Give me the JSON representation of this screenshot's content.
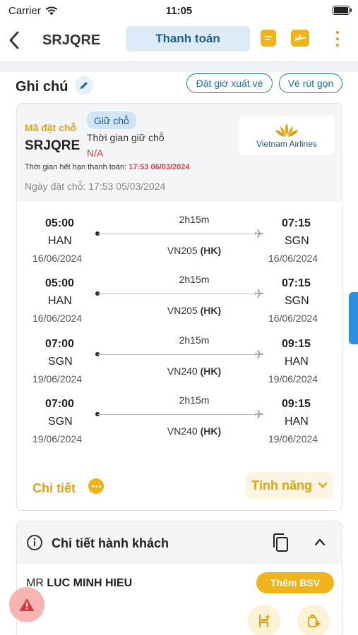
{
  "status_bar": {
    "carrier": "Carrier",
    "time": "11:05"
  },
  "header": {
    "title": "SRJQRE",
    "pay_tab": "Thanh toán"
  },
  "notes": {
    "label": "Ghi chú",
    "ticket_time_button": "Đặt giờ xuất vé",
    "short_ticket_button": "Vé rút gọn"
  },
  "booking": {
    "pnr_label": "Mã đặt chỗ",
    "pnr": "SRJQRE",
    "hold_badge": "Giữ chỗ",
    "hold_time_label": "Thời gian giữ chỗ",
    "hold_time_value": "N/A",
    "expire_label": "Thời gian hết hạn thanh toán:",
    "expire_value": "17:53 06/03/2024",
    "booking_date": "Ngày đặt chỗ: 17:53 05/03/2024",
    "airline": "Vietnam Airlines"
  },
  "flights": [
    {
      "dep_time": "05:00",
      "dep_code": "HAN",
      "dep_date": "16/06/2024",
      "duration": "2h15m",
      "flight_no": "VN205",
      "class": "(HK)",
      "arr_time": "07:15",
      "arr_code": "SGN",
      "arr_date": "16/06/2024"
    },
    {
      "dep_time": "05:00",
      "dep_code": "HAN",
      "dep_date": "16/06/2024",
      "duration": "2h15m",
      "flight_no": "VN205",
      "class": "(HK)",
      "arr_time": "07:15",
      "arr_code": "SGN",
      "arr_date": "16/06/2024"
    },
    {
      "dep_time": "07:00",
      "dep_code": "SGN",
      "dep_date": "19/06/2024",
      "duration": "2h15m",
      "flight_no": "VN240",
      "class": "(HK)",
      "arr_time": "09:15",
      "arr_code": "HAN",
      "arr_date": "19/06/2024"
    },
    {
      "dep_time": "07:00",
      "dep_code": "SGN",
      "dep_date": "19/06/2024",
      "duration": "2h15m",
      "flight_no": "VN240",
      "class": "(HK)",
      "arr_time": "09:15",
      "arr_code": "HAN",
      "arr_date": "19/06/2024"
    }
  ],
  "actions": {
    "detail_link": "Chi tiết",
    "feature_button": "Tính năng"
  },
  "passenger": {
    "section_title": "Chi tiết hành khách",
    "title_prefix": "MR",
    "name": "LUC MINH HIEU",
    "add_bsv": "Thêm BSV"
  },
  "colors": {
    "accent": "#f1b31c",
    "primary": "#1f6ea9",
    "danger": "#e03c3c"
  }
}
